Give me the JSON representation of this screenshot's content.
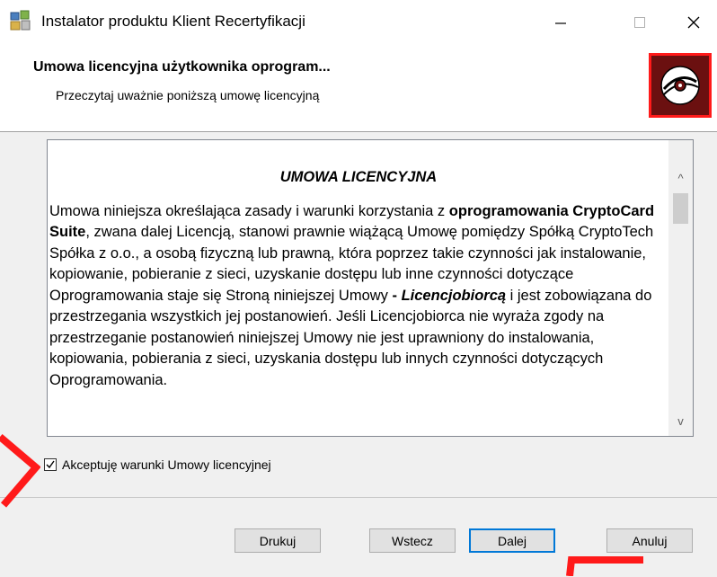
{
  "window": {
    "title": "Instalator produktu Klient Recertyfikacji",
    "minimize": "—",
    "maximize": "□",
    "close": "✕"
  },
  "header": {
    "title": "Umowa licencyjna użytkownika oprogram...",
    "subtitle": "Przeczytaj uważnie poniższą umowę licencyjną"
  },
  "license": {
    "heading": "UMOWA LICENCYJNA",
    "p_pre": "Umowa niniejsza określająca zasady i warunki korzystania z ",
    "p_bold": "oprogramowania CryptoCard Suite",
    "p_mid": ", zwana dalej Licencją, stanowi prawnie wiążącą Umowę pomiędzy Spółką CryptoTech Spółka z o.o., a osobą fizyczną lub prawną, która poprzez takie czynności jak instalowanie, kopiowanie, pobieranie z sieci, uzyskanie dostępu lub inne czynności dotyczące Oprogramowania staje się Stroną niniejszej Umowy ",
    "p_dash": "- ",
    "p_bolditalic": "Licencjobiorcą",
    "p_post": " i jest zobowiązana do przestrzegania wszystkich jej postanowień. Jeśli Licencjobiorca nie wyraża zgody na przestrzeganie postanowień niniejszej Umowy nie jest uprawniony do instalowania, kopiowania, pobierania z sieci, uzyskania dostępu lub innych czynności dotyczących Oprogramowania."
  },
  "scrollbar": {
    "up": "^",
    "down": "v"
  },
  "accept": {
    "label": "Akceptuję warunki Umowy licencyjnej",
    "checked": true
  },
  "buttons": {
    "print": "Drukuj",
    "back": "Wstecz",
    "next": "Dalej",
    "cancel": "Anuluj"
  },
  "colors": {
    "annotation_red": "#ff1a1a",
    "disk_bg": "#6b1010",
    "focus_blue": "#0078d7"
  },
  "icons": [
    "installer-app-icon",
    "disk-icon",
    "check-icon"
  ]
}
